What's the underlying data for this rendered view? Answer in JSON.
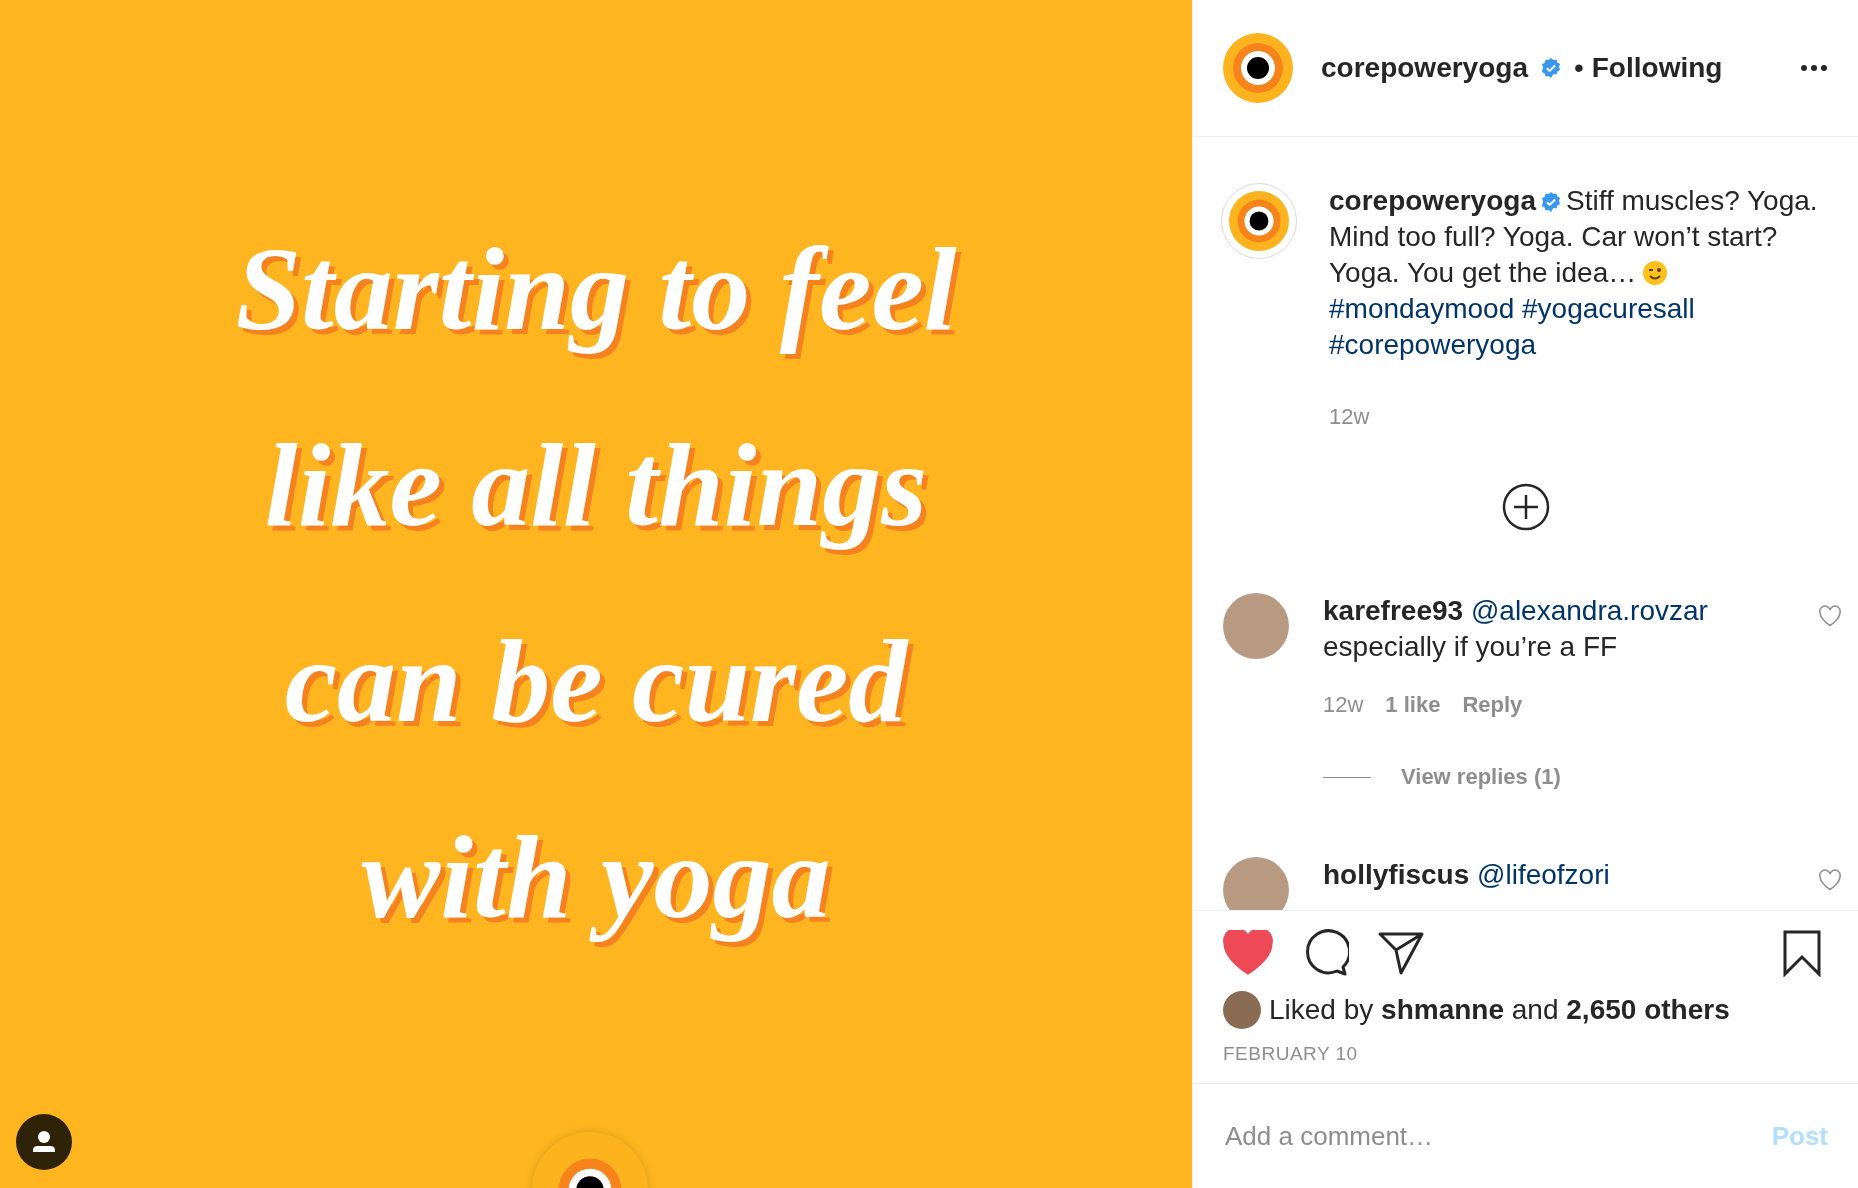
{
  "post_image": {
    "text_lines": [
      "Starting to feel",
      "like all things",
      "can be cured",
      "with yoga"
    ]
  },
  "header": {
    "username": "corepoweryoga",
    "verified": true,
    "separator": "•",
    "follow_status": "Following"
  },
  "caption": {
    "username": "corepoweryoga",
    "verified": true,
    "text": "Stiff muscles? Yoga. Mind too full? Yoga. Car won’t start? Yoga. You get the idea…",
    "hashtags": [
      "#mondaymood",
      "#yogacuresall",
      "#corepoweryoga"
    ],
    "time": "12w"
  },
  "comments": [
    {
      "username": "karefree93",
      "mention": "@alexandra.rovzar",
      "text": "especially if you’re a FF",
      "time": "12w",
      "likes": "1 like",
      "reply": "Reply",
      "view_replies": "View replies (1)",
      "liked": false
    },
    {
      "username": "hollyfiscus",
      "mention": "@lifeofzori",
      "liked": false
    }
  ],
  "actions": {
    "liked": true,
    "saved": false
  },
  "likes": "Liked by **shmanne** and **2,650 others**",
  "date": "FEBRUARY 10",
  "comment_box": {
    "placeholder": "Add a comment…",
    "post": "Post",
    "post_enabled": false
  }
}
